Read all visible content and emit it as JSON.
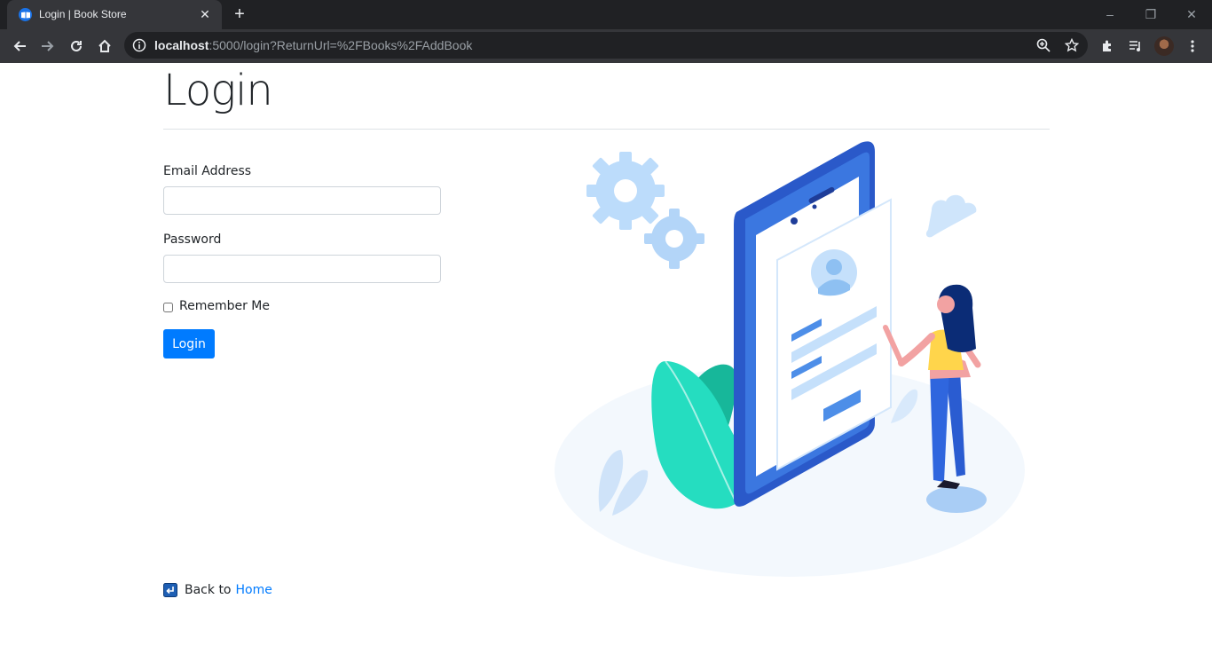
{
  "browser": {
    "tab_title": "Login | Book Store",
    "url_host": "localhost",
    "url_rest": ":5000/login?ReturnUrl=%2FBooks%2FAddBook"
  },
  "page": {
    "title": "Login",
    "email_label": "Email Address",
    "email_value": "",
    "password_label": "Password",
    "password_value": "",
    "remember_label": "Remember Me",
    "login_button": "Login",
    "back_prefix": "Back to",
    "back_link": "Home"
  },
  "colors": {
    "primary": "#007bff",
    "chrome_dark": "#202124",
    "chrome_tab": "#35363a"
  }
}
